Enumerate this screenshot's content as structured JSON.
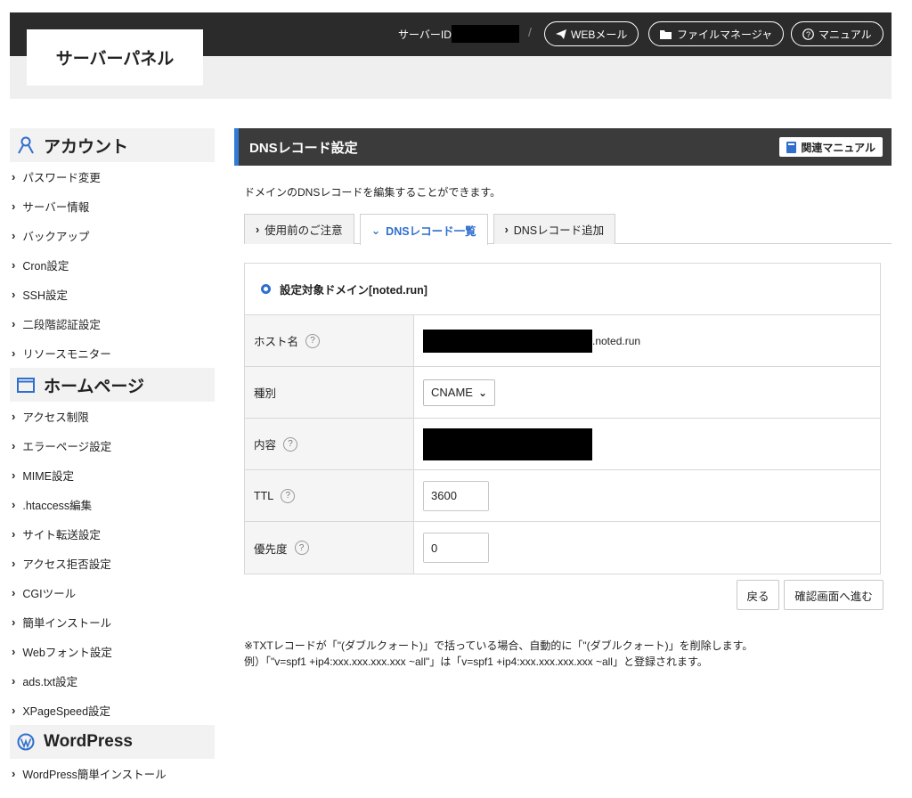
{
  "header": {
    "logo": "サーバーパネル",
    "server_id_label": "サーバーID",
    "slash": "/",
    "links": [
      "WEBメール",
      "ファイルマネージャ",
      "マニュアル"
    ]
  },
  "sidebar": {
    "sections": [
      {
        "title": "アカウント",
        "icon": "account-icon",
        "items": [
          "パスワード変更",
          "サーバー情報",
          "バックアップ",
          "Cron設定",
          "SSH設定",
          "二段階認証設定",
          "リソースモニター"
        ]
      },
      {
        "title": "ホームページ",
        "icon": "window-icon",
        "items": [
          "アクセス制限",
          "エラーページ設定",
          "MIME設定",
          ".htaccess編集",
          "サイト転送設定",
          "アクセス拒否設定",
          "CGIツール",
          "簡単インストール",
          "Webフォント設定",
          "ads.txt設定",
          "XPageSpeed設定"
        ]
      },
      {
        "title": "WordPress",
        "icon": "wordpress-icon",
        "items": [
          "WordPress簡単インストール"
        ]
      }
    ]
  },
  "main": {
    "title": "DNSレコード設定",
    "manual_button": "関連マニュアル",
    "description": "ドメインのDNSレコードを編集することができます。",
    "tabs": [
      {
        "label": "使用前のご注意",
        "active": false
      },
      {
        "label": "DNSレコード一覧",
        "active": true
      },
      {
        "label": "DNSレコード追加",
        "active": false
      }
    ],
    "domain_label": "設定対象ドメイン[noted.run]",
    "form": {
      "host_label": "ホスト名",
      "host_suffix": ".noted.run",
      "type_label": "種別",
      "type_value": "CNAME",
      "content_label": "内容",
      "ttl_label": "TTL",
      "ttl_value": "3600",
      "priority_label": "優先度",
      "priority_value": "0"
    },
    "back_button": "戻る",
    "confirm_button": "確認画面へ進む",
    "note_line1": "※TXTレコードが「\"(ダブルクォート)」で括っている場合、自動的に「\"(ダブルクォート)」を削除します。",
    "note_line2": "例）「\"v=spf1 +ip4:xxx.xxx.xxx.xxx ~all\"」は「v=spf1 +ip4:xxx.xxx.xxx.xxx ~all」と登録されます。"
  },
  "colors": {
    "accent": "#2f7bd6",
    "header_bg": "#2b2b2b",
    "panel_head_bg": "#3b3b3b"
  }
}
